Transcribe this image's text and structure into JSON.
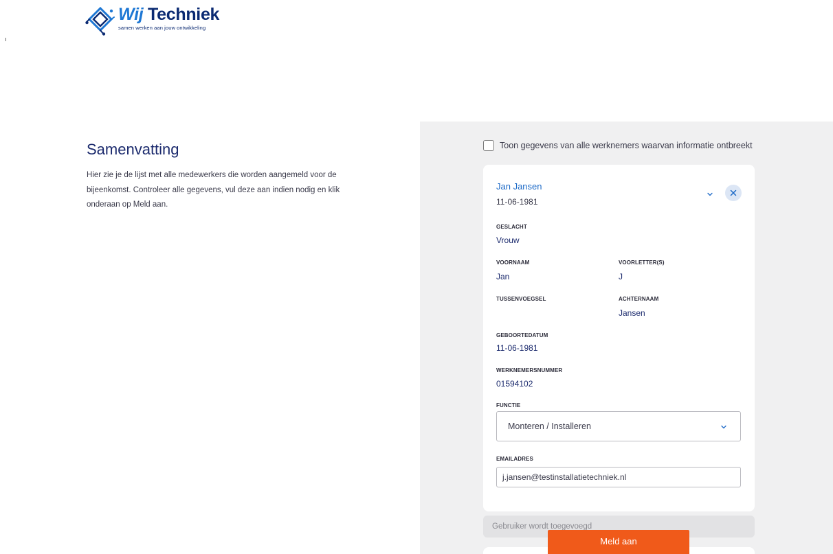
{
  "brand": {
    "name_part1": "Wij",
    "name_part2": "Techniek",
    "tagline": "samen werken aan jouw ontwikkeling",
    "primary_color": "#0b2a72",
    "accent_color": "#1d77d4"
  },
  "summary": {
    "title": "Samenvatting",
    "description": "Hier zie je de lijst met alle medewerkers die worden aangemeld voor de bijeenkomst. Controleer alle gegevens, vul deze aan indien nodig en klik onderaan op Meld aan."
  },
  "filter": {
    "show_all_label": "Toon gegevens van alle werknemers waarvan informatie ontbreekt",
    "checked": false
  },
  "employee": {
    "name": "Jan Jansen",
    "birthdate_header": "11-06-1981",
    "fields": {
      "gender_label": "GESLACHT",
      "gender_value": "Vrouw",
      "firstname_label": "VOORNAAM",
      "firstname_value": "Jan",
      "initials_label": "VOORLETTER(S)",
      "initials_value": "J",
      "infix_label": "TUSSENVOEGSEL",
      "infix_value": "",
      "lastname_label": "ACHTERNAAM",
      "lastname_value": "Jansen",
      "birthdate_label": "GEBOORTEDATUM",
      "birthdate_value": "11-06-1981",
      "employee_number_label": "WERKNEMERSNUMMER",
      "employee_number_value": "01594102",
      "function_label": "FUNCTIE",
      "function_value": "Monteren / Installeren",
      "email_label": "EMAILADRES",
      "email_value": "j.jansen@testinstallatietechniek.nl"
    }
  },
  "status": {
    "text": "Gebruiker wordt toegevoegd"
  },
  "actions": {
    "submit_label": "Meld aan",
    "submit_color": "#f05a1a"
  }
}
